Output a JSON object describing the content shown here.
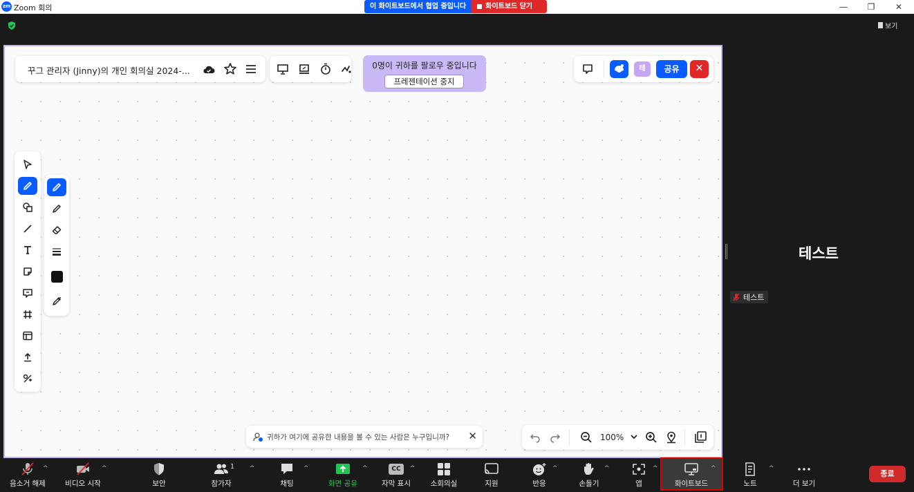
{
  "window": {
    "app_title": "Zoom 회의",
    "logo_text": "zm",
    "minimize": "—",
    "restore": "❐",
    "close": "✕"
  },
  "banner": {
    "collab_text": "이 화이트보드에서 협업 중입니다",
    "close_whiteboard": "화이트보드 닫기"
  },
  "topbar": {
    "view_label": "보기"
  },
  "whiteboard": {
    "doc_title": "꾸그 관리자 (Jinny)의 개인 회의실 2024-...",
    "follow_text": "0명이 귀하를 팔로우 중입니다",
    "stop_presentation": "프레젠테이션 중지",
    "avatar_initial": "테",
    "share_label": "공유",
    "close_label": "✕",
    "notice_text": "귀하가 여기에 공유한 내용을 볼 수 있는 사람은 누구입니까?",
    "notice_close": "✕",
    "zoom_value": "100%",
    "accent_color": "#0b5cff",
    "frame_color": "#c4b3f0"
  },
  "participant": {
    "name": "테스트",
    "tag_name": "테스트"
  },
  "bottom_toolbar": {
    "items": [
      {
        "label": "음소거 해제"
      },
      {
        "label": "비디오 시작"
      },
      {
        "label": "보안"
      },
      {
        "label": "참가자",
        "count": "1"
      },
      {
        "label": "채팅"
      },
      {
        "label": "화면 공유"
      },
      {
        "label": "자막 표시"
      },
      {
        "label": "소회의실"
      },
      {
        "label": "지원"
      },
      {
        "label": "반응"
      },
      {
        "label": "손들기"
      },
      {
        "label": "앱"
      },
      {
        "label": "화이트보드"
      },
      {
        "label": "노트"
      },
      {
        "label": "더 보기"
      }
    ],
    "end_label": "종료",
    "cc_icon_text": "CC"
  }
}
